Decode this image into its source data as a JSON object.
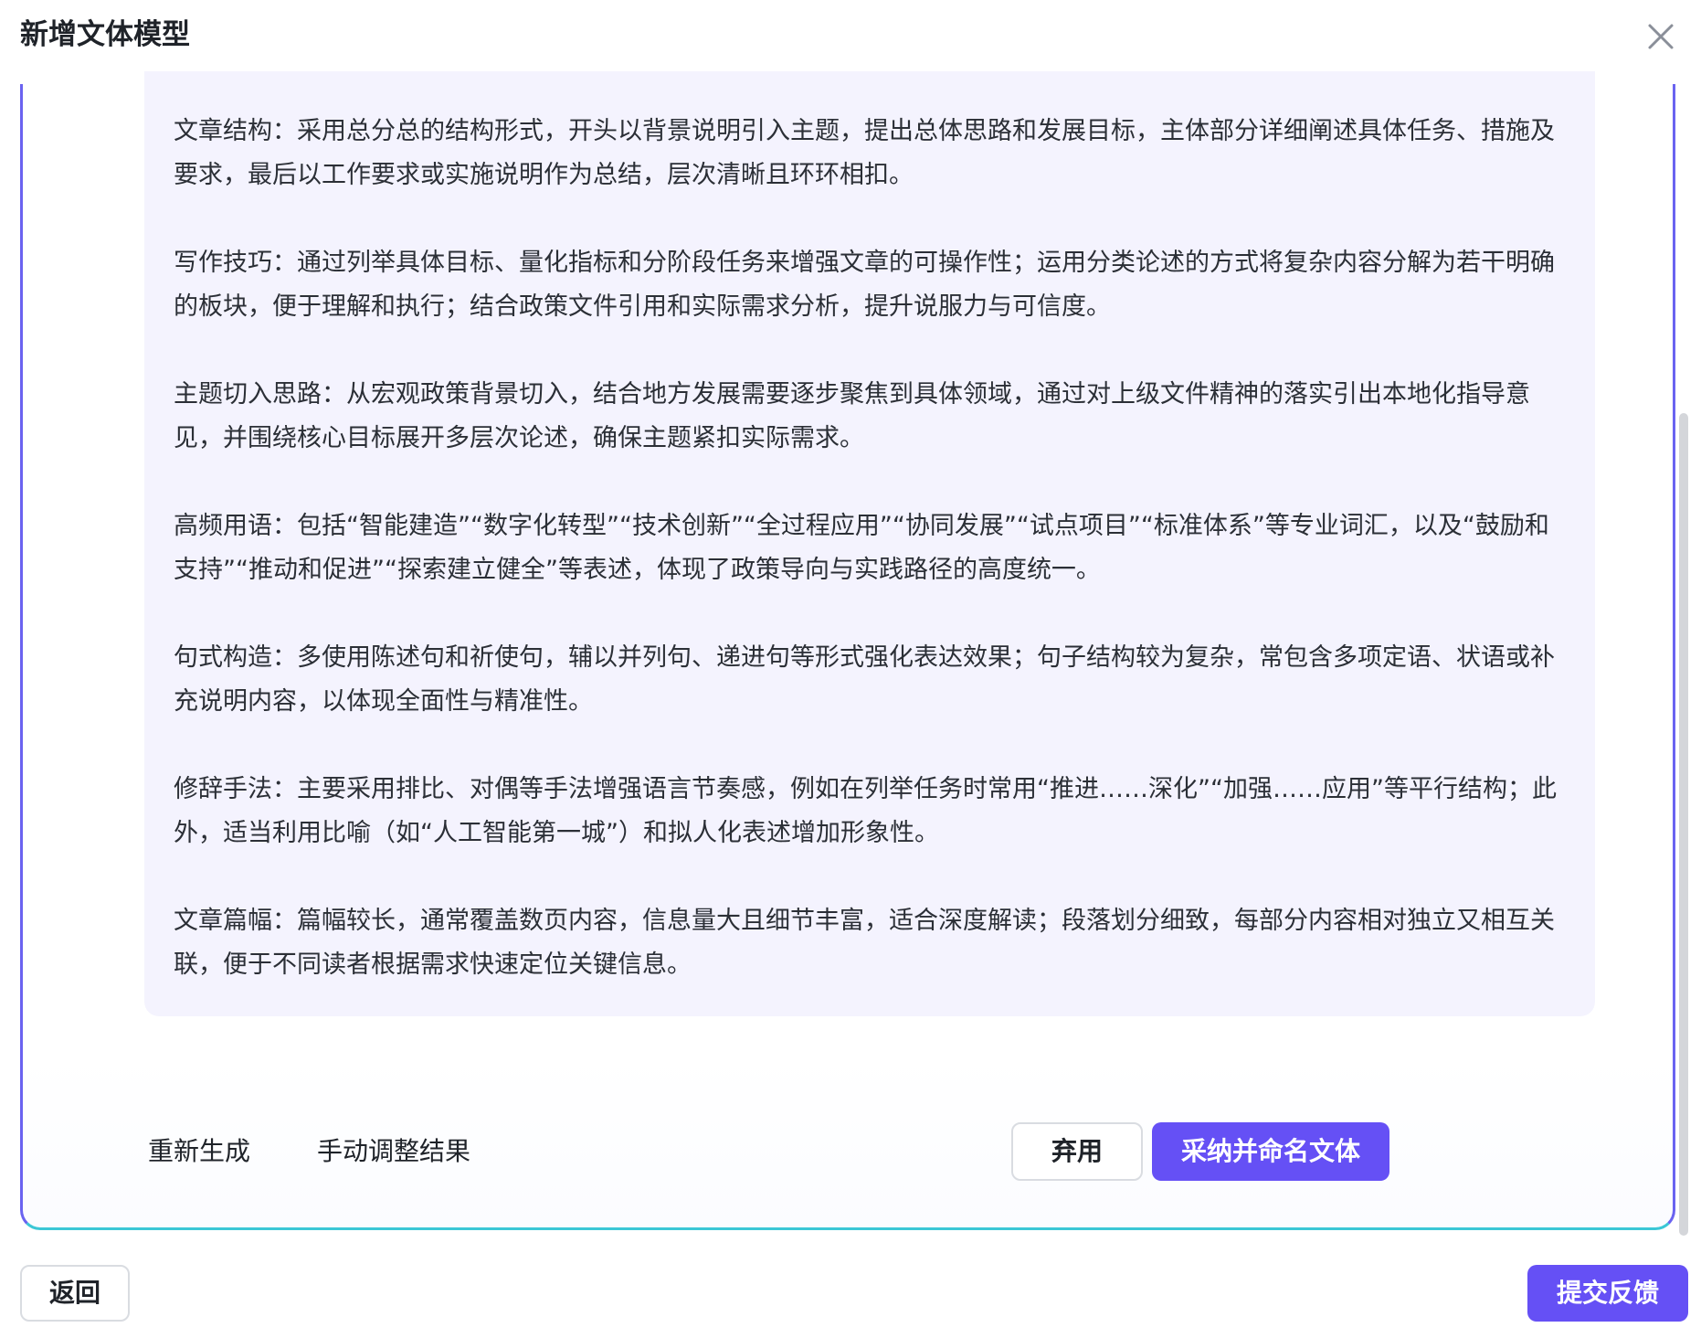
{
  "dialog": {
    "title": "新增文体模型"
  },
  "content": {
    "paragraphs": [
      "文章结构：采用总分总的结构形式，开头以背景说明引入主题，提出总体思路和发展目标，主体部分详细阐述具体任务、措施及要求，最后以工作要求或实施说明作为总结，层次清晰且环环相扣。",
      "写作技巧：通过列举具体目标、量化指标和分阶段任务来增强文章的可操作性；运用分类论述的方式将复杂内容分解为若干明确的板块，便于理解和执行；结合政策文件引用和实际需求分析，提升说服力与可信度。",
      "主题切入思路：从宏观政策背景切入，结合地方发展需要逐步聚焦到具体领域，通过对上级文件精神的落实引出本地化指导意见，并围绕核心目标展开多层次论述，确保主题紧扣实际需求。",
      "高频用语：包括“智能建造”“数字化转型”“技术创新”“全过程应用”“协同发展”“试点项目”“标准体系”等专业词汇，以及“鼓励和支持”“推动和促进”“探索建立健全”等表述，体现了政策导向与实践路径的高度统一。",
      "句式构造：多使用陈述句和祈使句，辅以并列句、递进句等形式强化表达效果；句子结构较为复杂，常包含多项定语、状语或补充说明内容，以体现全面性与精准性。",
      "修辞手法：主要采用排比、对偶等手法增强语言节奏感，例如在列举任务时常用“推进……深化”“加强……应用”等平行结构；此外，适当利用比喻（如“人工智能第一城”）和拟人化表述增加形象性。",
      "文章篇幅：篇幅较长，通常覆盖数页内容，信息量大且细节丰富，适合深度解读；段落划分细致，每部分内容相对独立又相互关联，便于不同读者根据需求快速定位关键信息。"
    ]
  },
  "actions": {
    "regenerate_label": "重新生成",
    "manual_adjust_label": "手动调整结果",
    "discard_label": "弃用",
    "adopt_label": "采纳并命名文体"
  },
  "footer": {
    "back_label": "返回",
    "feedback_label": "提交反馈"
  },
  "colors": {
    "accent": "#6550f5",
    "panel_border_top": "#6a63f0",
    "panel_border_bottom": "#3bc7d6",
    "card_background": "#f4f3fe"
  },
  "icons": {
    "close": "close-icon"
  }
}
